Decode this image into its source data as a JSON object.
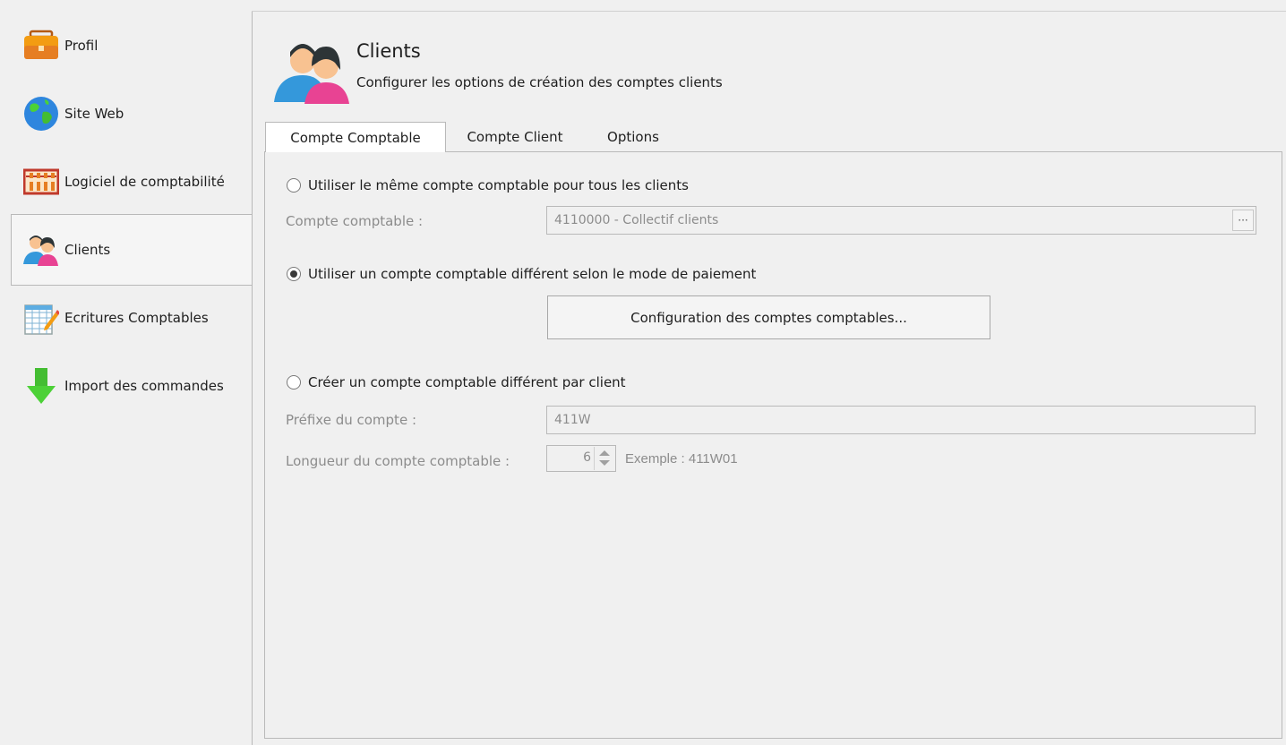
{
  "sidebar": {
    "items": [
      {
        "label": "Profil",
        "icon": "briefcase-icon"
      },
      {
        "label": "Site Web",
        "icon": "globe-icon"
      },
      {
        "label": "Logiciel de comptabilité",
        "icon": "abacus-icon"
      },
      {
        "label": "Clients",
        "icon": "users-icon",
        "selected": true
      },
      {
        "label": "Ecritures Comptables",
        "icon": "ledger-icon"
      },
      {
        "label": "Import des commandes",
        "icon": "download-arrow-icon"
      }
    ]
  },
  "header": {
    "title": "Clients",
    "subtitle": "Configurer les options de création des comptes clients"
  },
  "tabs": [
    {
      "label": "Compte Comptable",
      "active": true
    },
    {
      "label": "Compte Client",
      "active": false
    },
    {
      "label": "Options",
      "active": false
    }
  ],
  "panel": {
    "option_same": {
      "label": "Utiliser le même compte comptable pour tous les clients",
      "checked": false,
      "field_label": "Compte comptable :",
      "field_value": "4110000 - Collectif clients",
      "ellipsis": "···"
    },
    "option_payment": {
      "label": "Utiliser un compte comptable différent selon le mode de paiement",
      "checked": true,
      "button_label": "Configuration des comptes comptables..."
    },
    "option_per_client": {
      "label": "Créer un compte comptable différent par client",
      "checked": false,
      "prefix_label": "Préfixe du compte :",
      "prefix_value": "411W",
      "length_label": "Longueur du compte comptable :",
      "length_value": "6",
      "example": "Exemple : 411W01"
    }
  },
  "colors": {
    "background": "#f0f0f0",
    "border": "#b9b9b9",
    "disabled_text": "#8c8c8c"
  }
}
